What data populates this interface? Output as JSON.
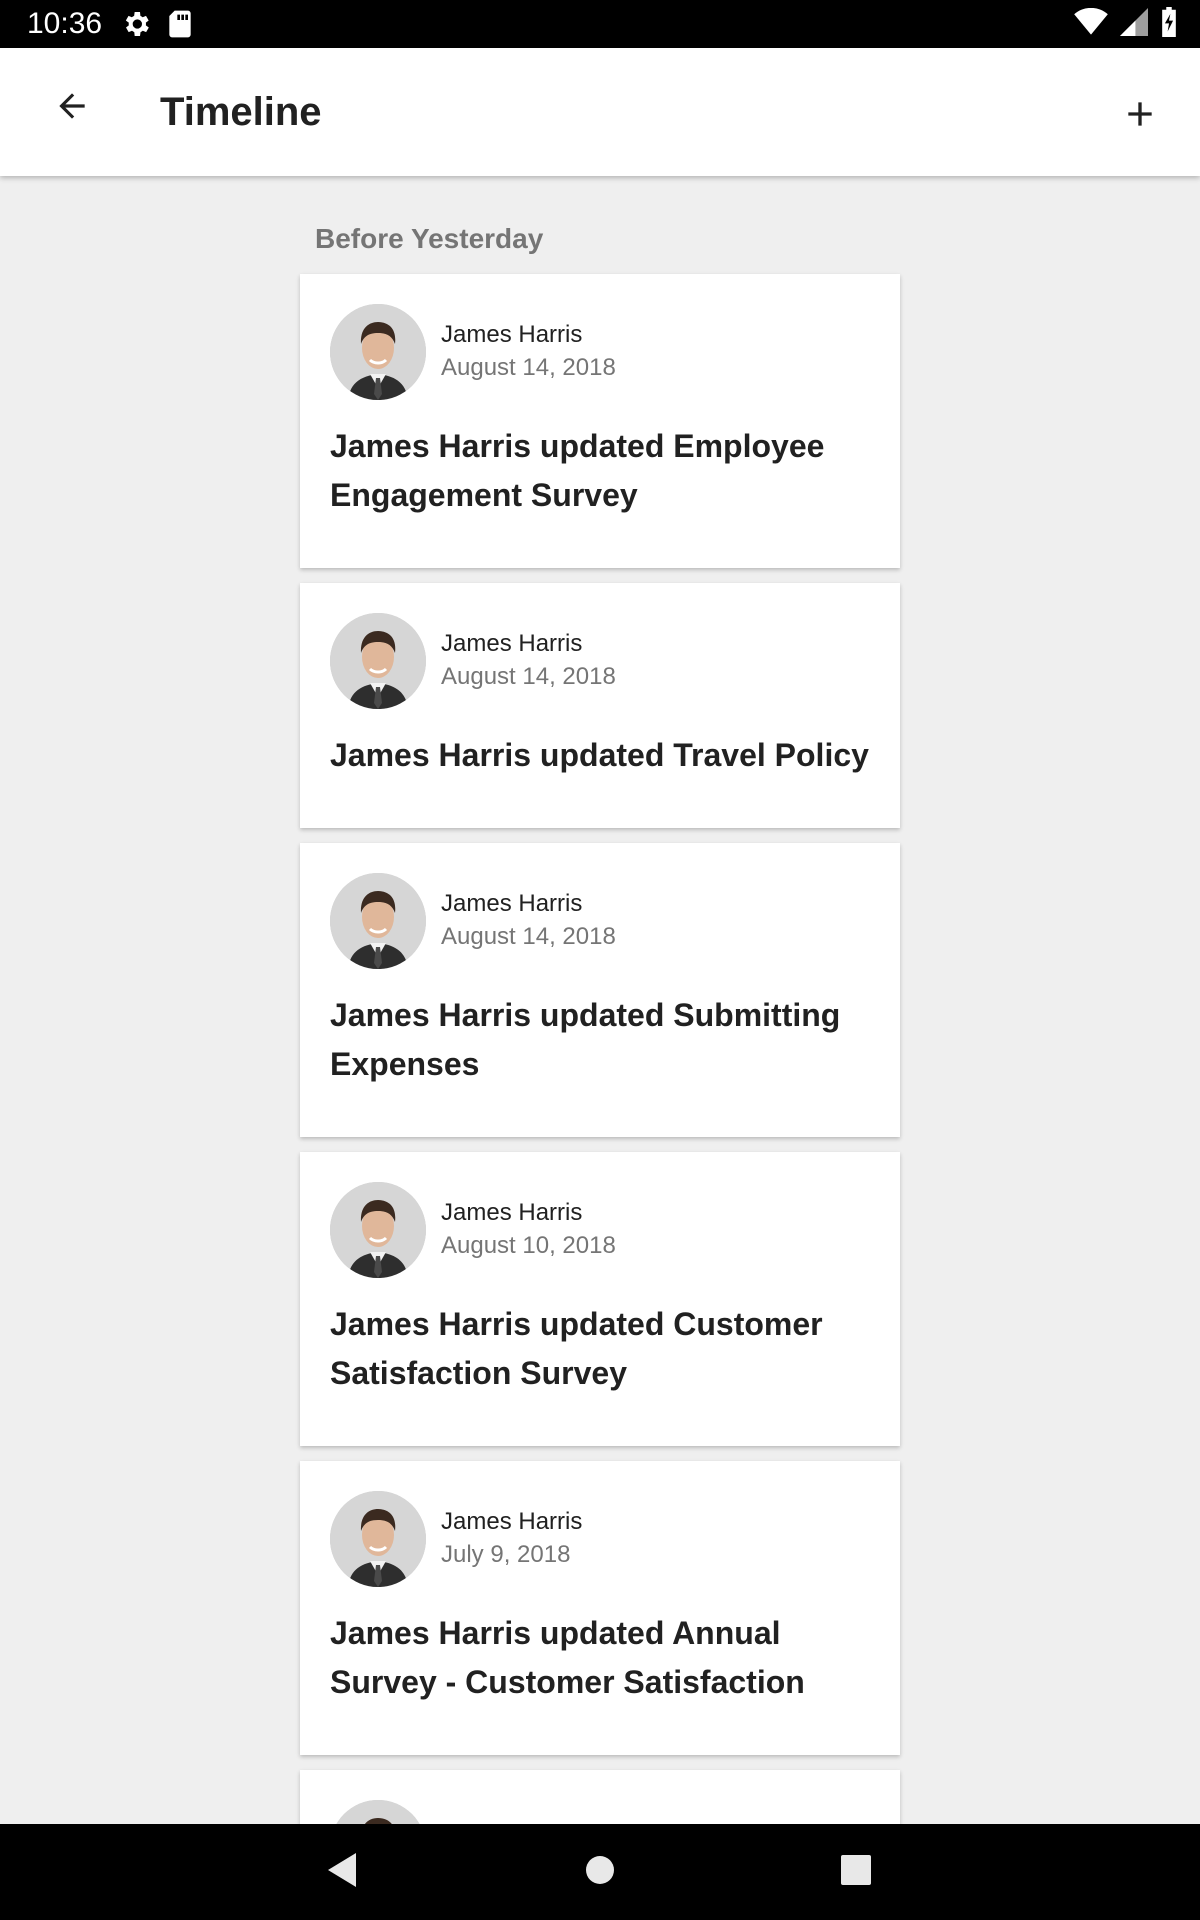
{
  "status_bar": {
    "time": "10:36",
    "icons": [
      "gear-icon",
      "sd-card-icon",
      "wifi-icon",
      "cell-signal-icon",
      "battery-charging-icon"
    ]
  },
  "app_bar": {
    "title": "Timeline",
    "back_icon": "arrow-back-icon",
    "add_icon": "plus-icon"
  },
  "timeline": {
    "section_header": "Before Yesterday",
    "items": [
      {
        "author": "James Harris",
        "date": "August 14, 2018",
        "title": "James Harris updated Employee Engagement Survey"
      },
      {
        "author": "James Harris",
        "date": "August 14, 2018",
        "title": "James Harris updated Travel Policy"
      },
      {
        "author": "James Harris",
        "date": "August 14, 2018",
        "title": "James Harris updated Submitting Expenses"
      },
      {
        "author": "James Harris",
        "date": "August 10, 2018",
        "title": "James Harris updated Customer Satisfaction Survey"
      },
      {
        "author": "James Harris",
        "date": "July 9, 2018",
        "title": "James Harris updated Annual Survey - Customer Satisfaction"
      }
    ]
  },
  "nav_bar": {
    "icons": [
      "nav-back-icon",
      "nav-home-icon",
      "nav-recents-icon"
    ]
  }
}
